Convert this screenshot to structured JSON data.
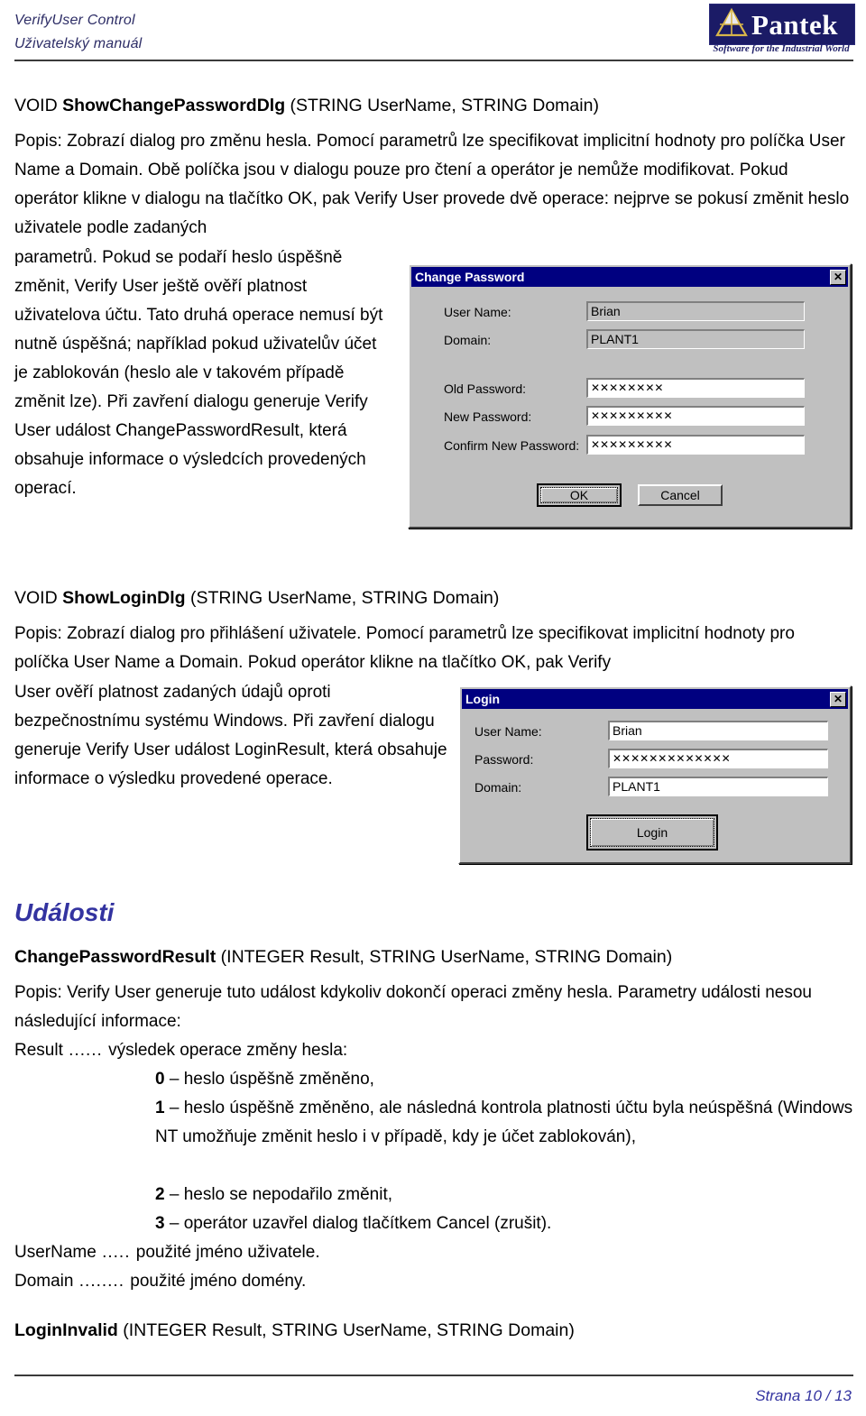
{
  "header": {
    "line1": "VerifyUser Control",
    "line2": "Uživatelský manuál",
    "logo_word": "Pantek",
    "logo_tagline": "Software for the Industrial World"
  },
  "sections": {
    "change_password": {
      "signature_void": "VOID ",
      "signature_name": "ShowChangePasswordDlg",
      "signature_args": " (STRING UserName, STRING Domain)",
      "paragraph_full": "Popis: Zobrazí dialog pro změnu hesla. Pomocí parametrů lze specifikovat implicitní hodnoty pro políčka User Name a Domain. Obě políčka jsou v dialogu pouze pro čtení a operátor je nemůže modifikovat. Pokud operátor klikne v dialogu na tlačítko OK, pak Verify User provede dvě operace: nejprve se pokusí změnit heslo uživatele podle zadaných",
      "paragraph_narrow": "parametrů. Pokud se podaří heslo úspěšně změnit, Verify User ještě ověří platnost uživatelova účtu. Tato druhá operace nemusí být nutně úspěšná; například pokud uživatelův účet je zablokován (heslo ale v takovém případě změnit lze). Při zavření dialogu generuje Verify User událost ChangePasswordResult, která obsahuje informace o výsledcích provedených operací."
    },
    "show_login": {
      "signature_void": "VOID ",
      "signature_name": "ShowLoginDlg",
      "signature_args": " (STRING UserName, STRING Domain)",
      "paragraph_full": "Popis: Zobrazí dialog pro přihlášení uživatele. Pomocí parametrů lze specifikovat implicitní hodnoty pro políčka User Name a Domain. Pokud operátor klikne na tlačítko OK, pak Verify",
      "paragraph_narrow": "User ověří platnost zadaných údajů oproti bezpečnostnímu systému Windows. Při zavření dialogu generuje Verify User událost LoginResult, která obsahuje informace o výsledku provedené operace."
    },
    "events": {
      "heading": "Události",
      "event1_name": "ChangePasswordResult",
      "event1_args": " (INTEGER Result, STRING UserName, STRING Domain)",
      "event1_desc": "Popis: Verify User generuje tuto událost kdykoliv dokončí operaci změny hesla. Parametry události nesou následující informace:",
      "result_label": "Result",
      "result_dots": " ...... ",
      "result_desc": "výsledek operace změny hesla:",
      "result_values": [
        {
          "code": "0",
          "sep": " – ",
          "text": "heslo úspěšně změněno,"
        },
        {
          "code": "1",
          "sep": " – ",
          "text": "heslo úspěšně změněno, ale následná kontrola platnosti účtu byla neúspěšná (Windows NT umožňuje změnit heslo i v případě, kdy je účet zablokován),"
        },
        {
          "code": "2",
          "sep": " – ",
          "text": "heslo se nepodařilo změnit,"
        },
        {
          "code": "3",
          "sep": " – ",
          "text": "operátor uzavřel dialog tlačítkem Cancel (zrušit)."
        }
      ],
      "username_label": "UserName",
      "username_dots": " ..... ",
      "username_desc": "použité jméno uživatele.",
      "domain_label": "Domain",
      "domain_dots": " ........ ",
      "domain_desc": "použité jméno domény.",
      "event2_name": "LoginInvalid",
      "event2_args": " (INTEGER Result, STRING UserName, STRING Domain)"
    }
  },
  "change_password_dialog": {
    "title": "Change Password",
    "close_glyph": "✕",
    "fields": [
      {
        "label": "User Name:",
        "value": "Brian",
        "readonly": true
      },
      {
        "label": "Domain:",
        "value": "PLANT1",
        "readonly": true
      },
      {
        "label": "Old Password:",
        "value": "✕✕✕✕✕✕✕✕",
        "readonly": false
      },
      {
        "label": "New Password:",
        "value": "✕✕✕✕✕✕✕✕✕",
        "readonly": false
      },
      {
        "label": "Confirm New Password:",
        "value": "✕✕✕✕✕✕✕✕✕",
        "readonly": false
      }
    ],
    "ok_label": "OK",
    "cancel_label": "Cancel"
  },
  "login_dialog": {
    "title": "Login",
    "close_glyph": "✕",
    "fields": [
      {
        "label": "User Name:",
        "value": "Brian"
      },
      {
        "label": "Password:",
        "value": "✕✕✕✕✕✕✕✕✕✕✕✕✕"
      },
      {
        "label": "Domain:",
        "value": "PLANT1"
      }
    ],
    "login_label": "Login"
  },
  "footer": {
    "page_text": "Strana 10 / 13"
  },
  "colors": {
    "accent_blue": "#3333a0",
    "header_blue": "#2d2d66",
    "logo_navy": "#1b1b66",
    "titlebar_navy": "#000080",
    "dialog_face": "#c0c0c0"
  }
}
